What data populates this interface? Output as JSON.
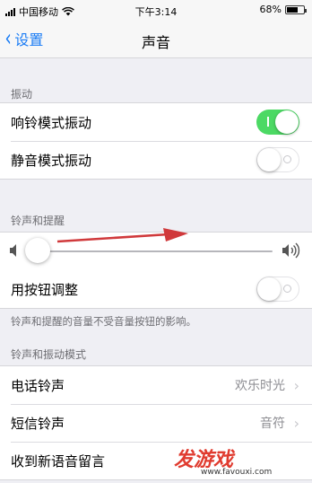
{
  "status": {
    "carrier": "中国移动",
    "time": "下午3:14",
    "battery": "68%",
    "battery_level": 0.68
  },
  "nav": {
    "back_label": "设置",
    "title": "声音"
  },
  "vibration": {
    "header": "振动",
    "ring_label": "响铃模式振动",
    "ring_on": true,
    "silent_label": "静音模式振动",
    "silent_on": false
  },
  "ringer": {
    "header": "铃声和提醒",
    "volume_level": 0.03,
    "buttons_label": "用按钮调整",
    "buttons_on": false,
    "footnote": "铃声和提醒的音量不受音量按钮的影响。"
  },
  "patterns": {
    "header": "铃声和振动模式",
    "items": [
      {
        "label": "电话铃声",
        "value": "欢乐时光"
      },
      {
        "label": "短信铃声",
        "value": "音符"
      },
      {
        "label": "收到新语音留言",
        "value": ""
      }
    ]
  },
  "watermark": {
    "logo": "发游戏",
    "url": "www.favouxi.com"
  },
  "colors": {
    "accent": "#1a7cf5",
    "toggle_on": "#4cd964",
    "annotation_arrow": "#d0393b"
  }
}
